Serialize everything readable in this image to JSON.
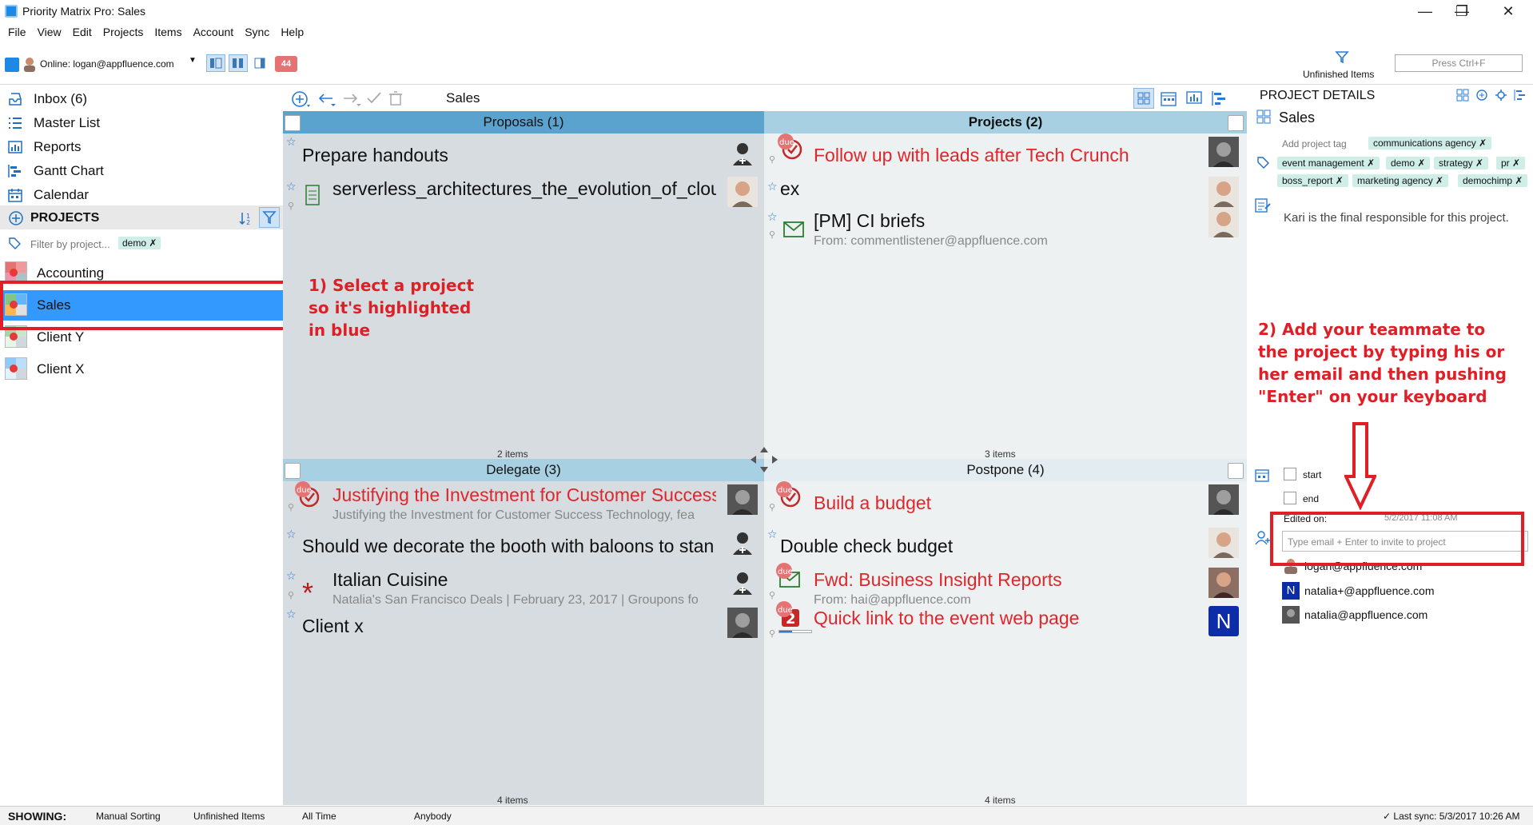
{
  "window": {
    "title": "Priority Matrix Pro: Sales",
    "minimize": "—",
    "restore": "❐",
    "close": "✕"
  },
  "menu": [
    "File",
    "View",
    "Edit",
    "Projects",
    "Items",
    "Account",
    "Sync",
    "Help"
  ],
  "toolbar": {
    "online_text": "Online: logan@appfluence.com",
    "badge_count": "44",
    "unfinished_label": "Unfinished Items",
    "search_placeholder": "Press Ctrl+F"
  },
  "sidebar": {
    "nav": [
      {
        "label": "Inbox (6)",
        "icon": "inbox-icon"
      },
      {
        "label": "Master List",
        "icon": "list-icon"
      },
      {
        "label": "Reports",
        "icon": "reports-icon"
      },
      {
        "label": "Gantt Chart",
        "icon": "gantt-icon"
      },
      {
        "label": "Calendar",
        "icon": "calendar-icon"
      }
    ],
    "projects_header": "PROJECTS",
    "filter_placeholder": "Filter by project...",
    "filter_tag": "demo ✗",
    "projects": [
      {
        "name": "Accounting",
        "selected": false
      },
      {
        "name": "Sales",
        "selected": true
      },
      {
        "name": "Client Y",
        "selected": false
      },
      {
        "name": "Client X",
        "selected": false
      }
    ]
  },
  "matrix": {
    "project_title": "Sales",
    "quadrants": [
      {
        "name": "Proposals (1)",
        "count": "2 items",
        "tasks": [
          {
            "title": "Prepare handouts",
            "red": false
          },
          {
            "title": "serverless_architectures_the_evolution_of_clou",
            "red": false
          }
        ]
      },
      {
        "name": "Projects (2)",
        "count": "3 items",
        "tasks": [
          {
            "title": "Follow up with leads after Tech Crunch",
            "red": true
          },
          {
            "title": "ex",
            "red": false
          },
          {
            "title": "[PM] CI briefs",
            "sub": "From: commentlistener@appfluence.com",
            "red": false
          }
        ]
      },
      {
        "name": "Delegate (3)",
        "count": "4 items",
        "tasks": [
          {
            "title": "Justifying the Investment for Customer Success",
            "sub": "Justifying the Investment for Customer Success Technology, fea",
            "red": true
          },
          {
            "title": "Should we decorate the booth with baloons to stan",
            "red": false
          },
          {
            "title": "Italian Cuisine",
            "sub": "Natalia's San Francisco Deals | February 23, 2017 | Groupons fo",
            "red": false
          },
          {
            "title": "Client x",
            "red": false
          }
        ]
      },
      {
        "name": "Postpone (4)",
        "count": "4 items",
        "tasks": [
          {
            "title": "Build a budget",
            "red": true
          },
          {
            "title": "Double check budget",
            "red": false
          },
          {
            "title": "Fwd: Business Insight Reports",
            "sub": "From: hai@appfluence.com",
            "red": true
          },
          {
            "title": "Quick link to the event web page",
            "red": true
          }
        ]
      }
    ],
    "due_label": "due",
    "n_avatar": "N",
    "badge_two": "2"
  },
  "details": {
    "header": "PROJECT DETAILS",
    "project_name": "Sales",
    "add_tag_placeholder": "Add project tag",
    "tags": [
      "communications agency ✗",
      "event management ✗",
      "demo ✗",
      "strategy ✗",
      "pr ✗",
      "boss_report ✗",
      "marketing agency ✗",
      "demochimp ✗"
    ],
    "description": "Kari is the final responsible for this project.",
    "start_label": "start",
    "end_label": "end",
    "edited_label": "Edited on:",
    "edited_value": "5/2/2017 11:08 AM",
    "invite_placeholder": "Type email + Enter to invite to project",
    "members": [
      "logan@appfluence.com",
      "natalia+@appfluence.com",
      "natalia@appfluence.com"
    ]
  },
  "annotations": {
    "step1": [
      "1) Select a project",
      "so it's highlighted",
      "in blue"
    ],
    "step2": [
      "2) Add your teammate to",
      "the project by typing his or",
      "her email and then pushing",
      "\"Enter\" on your keyboard"
    ]
  },
  "status": {
    "showing": "SHOWING:",
    "sorting": "Manual Sorting",
    "filter": "Unfinished Items",
    "time": "All Time",
    "who": "Anybody",
    "last_sync": "✓ Last sync: 5/3/2017 10:26 AM"
  },
  "colors": {
    "accent_blue": "#3399ff",
    "header_blue": "#5aa3cf",
    "header_light": "#a7d0e2",
    "annotation_red": "#e01e25",
    "quad_gray": "#d6dcdf",
    "quad_light": "#eef1f2"
  }
}
